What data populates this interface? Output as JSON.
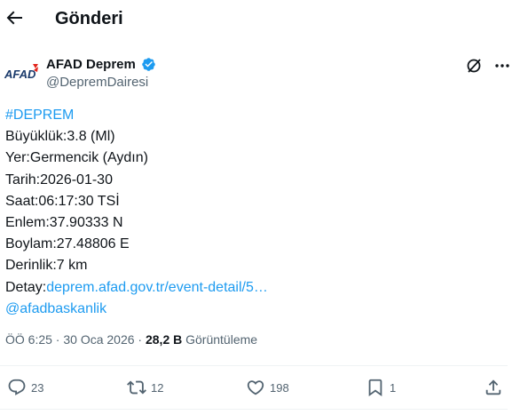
{
  "header": {
    "title": "Gönderi",
    "back_icon": "arrow-left-icon"
  },
  "author": {
    "avatar_text": "AFAD",
    "display_name": "AFAD Deprem",
    "handle": "@DepremDairesi",
    "verified_color": "#1d9bf0"
  },
  "tweet": {
    "hashtag": "#DEPREM",
    "lines": [
      "Büyüklük:3.8 (Ml)",
      "Yer:Germencik (Aydın)",
      "Tarih:2026-01-30",
      "Saat:06:17:30 TSİ",
      "Enlem:37.90333 N",
      "Boylam:27.48806 E",
      "Derinlik:7 km"
    ],
    "detail_label": "Detay:",
    "detail_link": "deprem.afad.gov.tr/event-detail/5…",
    "mention": "@afadbaskanlik"
  },
  "meta": {
    "timestamp": "ÖÖ 6:25 · 30 Oca 2026",
    "separator": " · ",
    "views_count": "28,2 B",
    "views_label": "Görüntüleme"
  },
  "actions": {
    "replies": "23",
    "retweets": "12",
    "likes": "198",
    "bookmarks": "1"
  },
  "colors": {
    "link": "#1d9bf0",
    "text": "#0f1419",
    "secondary": "#536471",
    "brand_red": "#e2231a"
  }
}
